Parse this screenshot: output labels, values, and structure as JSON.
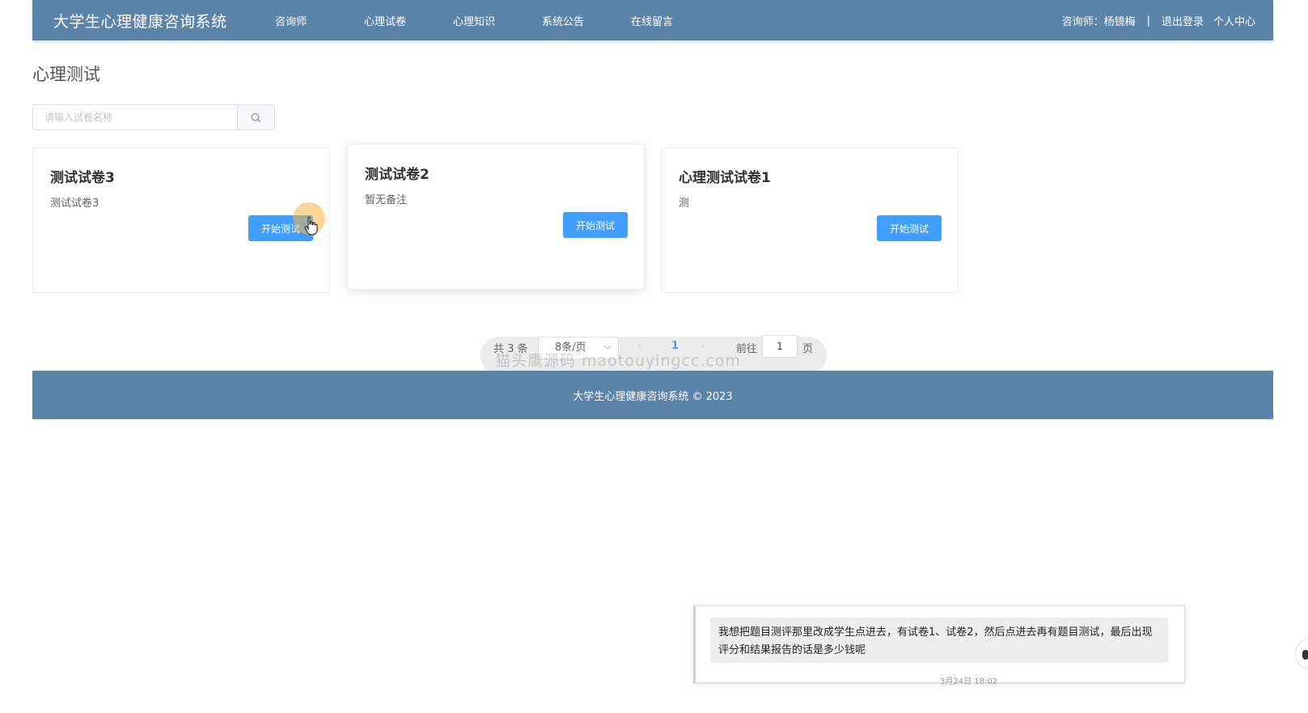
{
  "navbar": {
    "brand": "大学生心理健康咨询系统",
    "links": [
      "咨询师",
      "心理试卷",
      "心理知识",
      "系统公告",
      "在线留言"
    ],
    "user_label": "咨询师：杨镜梅",
    "separator": "|",
    "logout": "退出登录",
    "profile": "个人中心"
  },
  "page": {
    "title": "心理测试"
  },
  "search": {
    "placeholder": "请输入试卷名称"
  },
  "cards": [
    {
      "title": "测试试卷3",
      "desc": "测试试卷3",
      "button": "开始测试"
    },
    {
      "title": "测试试卷2",
      "desc": "暂无备注",
      "button": "开始测试"
    },
    {
      "title": "心理测试试卷1",
      "desc": "测",
      "button": "开始测试"
    }
  ],
  "pagination": {
    "total": "共 3 条",
    "page_size": "8条/页",
    "prev": "‹",
    "current": "1",
    "next": "›",
    "goto_label": "前往",
    "goto_value": "1",
    "page_unit": "页",
    "watermark": "猫头鹰源码 maotouyingcc.com"
  },
  "footer": {
    "text": "大学生心理健康咨询系统 © 2023"
  },
  "chat": {
    "message_line1": "我想把题目测评那里改成学生点进去，有试卷1、试卷2，然后点进去再有题目测试，最后出现",
    "message_line2": "评分和结果报告的话是多少钱呢",
    "time": "3月24日 18:02"
  },
  "colors": {
    "navbar": "#5b84a8",
    "primary": "#409eff"
  }
}
